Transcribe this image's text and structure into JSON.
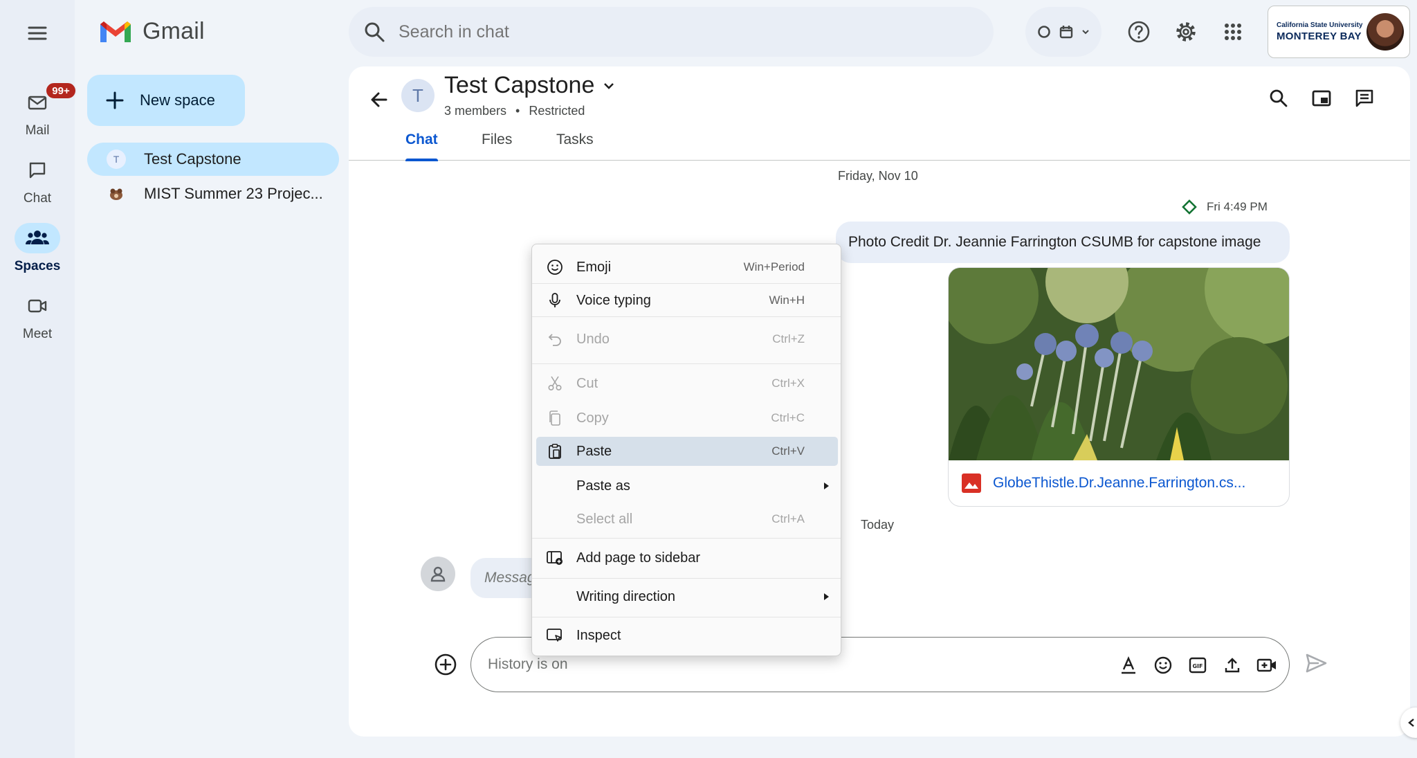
{
  "app": {
    "logo_text": "Gmail"
  },
  "rail": {
    "items": [
      {
        "label": "Mail",
        "icon": "mail-icon",
        "badge": "99+"
      },
      {
        "label": "Chat",
        "icon": "chat-icon"
      },
      {
        "label": "Spaces",
        "icon": "spaces-icon",
        "active": true
      },
      {
        "label": "Meet",
        "icon": "meet-icon"
      }
    ]
  },
  "search": {
    "placeholder": "Search in chat"
  },
  "account": {
    "org_line1": "California State University",
    "org_line2": "MONTEREY BAY"
  },
  "sidebar": {
    "new_space_label": "New space",
    "spaces": [
      {
        "name": "Test Capstone",
        "avatar_letter": "T",
        "active": true
      },
      {
        "name": "MIST Summer 23 Projec..."
      }
    ]
  },
  "space": {
    "avatar_letter": "T",
    "title": "Test Capstone",
    "members": "3 members",
    "separator": "•",
    "access": "Restricted",
    "tabs": [
      "Chat",
      "Files",
      "Tasks"
    ]
  },
  "messages": {
    "date_1": "Friday, Nov 10",
    "time": "Fri 4:49 PM",
    "text": "Photo Credit Dr. Jeannie Farrington CSUMB for capstone image",
    "attachment_name": "GlobeThistle.Dr.Jeanne.Farrington.cs...",
    "date_2": "Today",
    "pending_text": "Message"
  },
  "compose": {
    "placeholder": "History is on"
  },
  "context_menu": {
    "items": [
      {
        "label": "Emoji",
        "shortcut": "Win+Period",
        "icon": "emoji-icon",
        "enabled": true
      },
      {
        "label": "Voice typing",
        "shortcut": "Win+H",
        "icon": "microphone-icon",
        "enabled": true
      },
      {
        "label": "Undo",
        "shortcut": "Ctrl+Z",
        "icon": "undo-icon",
        "enabled": false
      },
      {
        "label": "Cut",
        "shortcut": "Ctrl+X",
        "icon": "scissors-icon",
        "enabled": false
      },
      {
        "label": "Copy",
        "shortcut": "Ctrl+C",
        "icon": "copy-icon",
        "enabled": false
      },
      {
        "label": "Paste",
        "shortcut": "Ctrl+V",
        "icon": "paste-icon",
        "enabled": true,
        "highlighted": true
      },
      {
        "label": "Paste as",
        "submenu": true,
        "enabled": true
      },
      {
        "label": "Select all",
        "shortcut": "Ctrl+A",
        "enabled": false
      },
      {
        "label": "Add page to sidebar",
        "icon": "add-to-sidebar-icon",
        "enabled": true
      },
      {
        "label": "Writing direction",
        "submenu": true,
        "enabled": true
      },
      {
        "label": "Inspect",
        "icon": "inspect-icon",
        "enabled": true
      }
    ]
  },
  "colors": {
    "accent": "#0b57d0",
    "active_bg": "#c2e7ff",
    "badge": "#b3261e",
    "attachment_icon": "#d93025"
  }
}
